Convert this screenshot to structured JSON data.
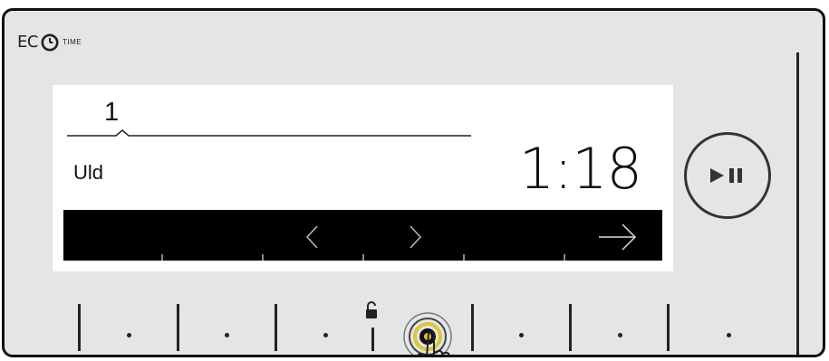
{
  "header": {
    "logo_main": "EC",
    "logo_small": "TIME",
    "logo_icon": "clock-icon"
  },
  "display": {
    "program_number": "1",
    "program_name": "Uld",
    "time_remaining": "1:18",
    "nav_bar": {
      "icons": [
        "chevron-left-icon",
        "chevron-right-icon",
        "arrow-right-icon"
      ]
    }
  },
  "controls": {
    "play_pause_icon": "play-pause-icon",
    "lock_icon": "padlock-icon",
    "touch_icon": "hand-pointer-icon"
  },
  "colors": {
    "panel": "#e4e5e6",
    "screen": "#ffffff",
    "nav_bar": "#000000",
    "yellow_ring": "#d9c63a"
  }
}
